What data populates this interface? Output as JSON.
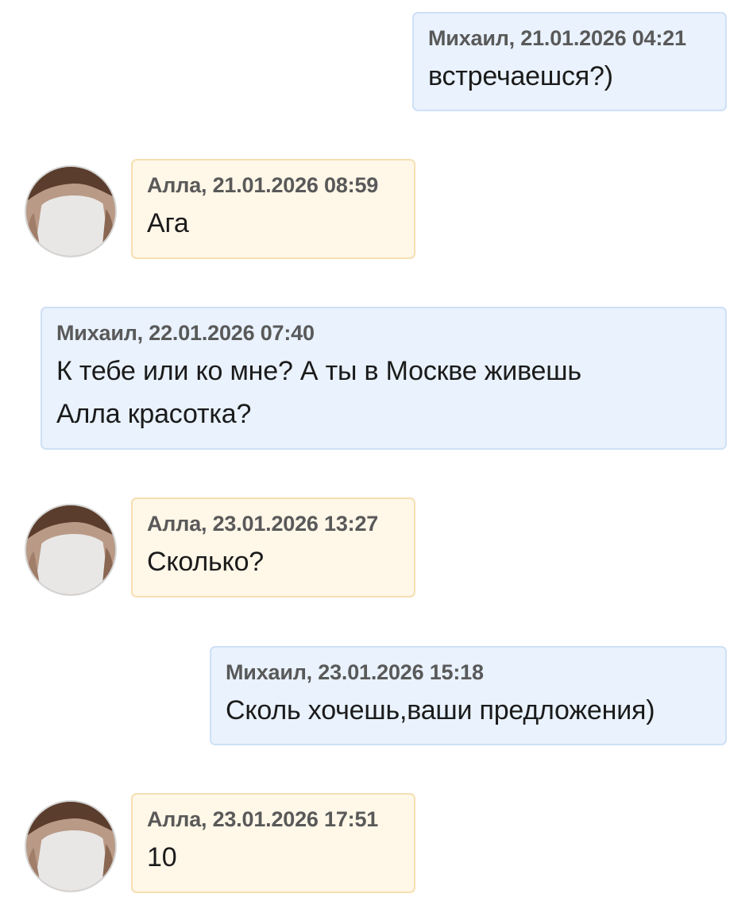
{
  "messages": [
    {
      "direction": "out",
      "author": "Михаил",
      "meta": "Михаил, 21.01.2026 04:21",
      "lines": [
        "встречаешся?)"
      ]
    },
    {
      "direction": "in",
      "author": "Алла",
      "meta": "Алла, 21.01.2026 08:59",
      "lines": [
        "Ага"
      ]
    },
    {
      "direction": "out",
      "author": "Михаил",
      "meta": "Михаил, 22.01.2026 07:40",
      "lines": [
        "К тебе или ко мне? А ты в Москве живешь",
        "Алла красотка?"
      ]
    },
    {
      "direction": "in",
      "author": "Алла",
      "meta": "Алла, 23.01.2026 13:27",
      "lines": [
        "Сколько?"
      ]
    },
    {
      "direction": "out",
      "author": "Михаил",
      "meta": "Михаил, 23.01.2026 15:18",
      "lines": [
        "Сколь хочешь,ваши предложения)"
      ]
    },
    {
      "direction": "in",
      "author": "Алла",
      "meta": "Алла, 23.01.2026 17:51",
      "lines": [
        "10"
      ]
    }
  ]
}
